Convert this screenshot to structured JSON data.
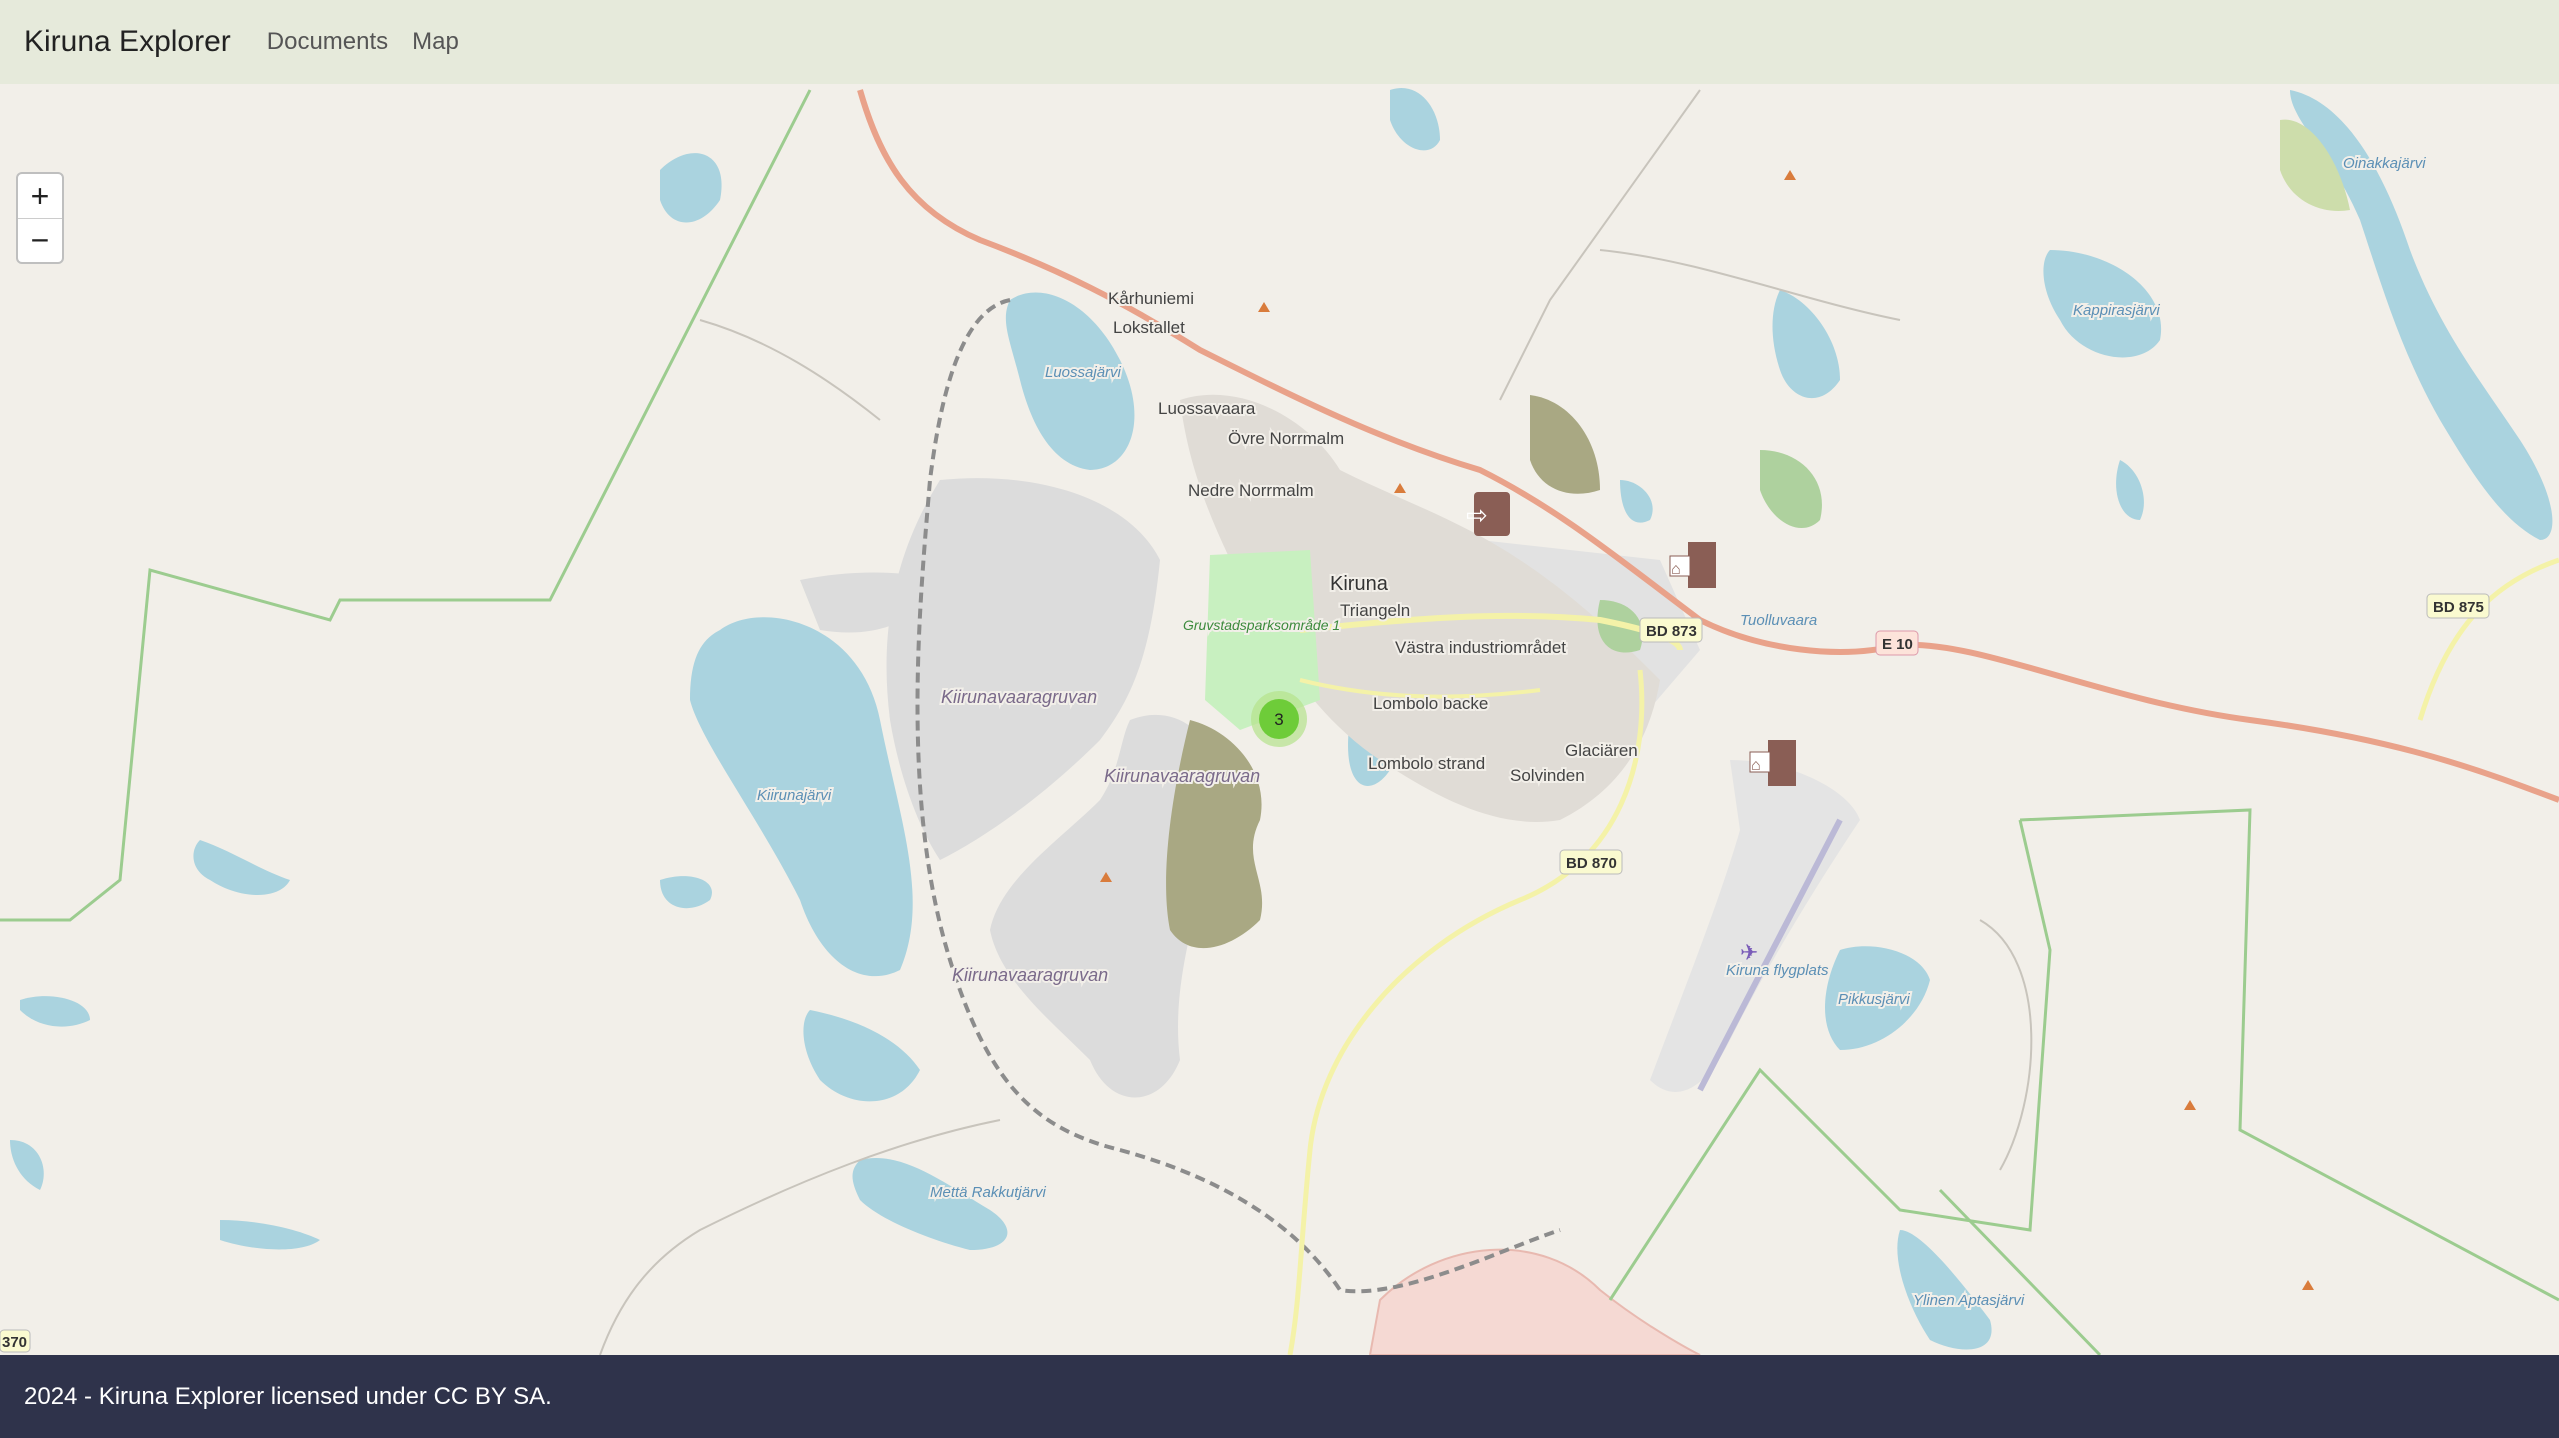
{
  "navbar": {
    "brand": "Kiruna Explorer",
    "links": [
      "Documents",
      "Map"
    ]
  },
  "map": {
    "zoom_in": "+",
    "zoom_out": "−",
    "cluster_count": "3",
    "places": [
      "Kårhuniemi",
      "Lokstallet",
      "Luossavaara",
      "Övre Norrmalm",
      "Nedre Norrmalm",
      "Kiruna",
      "Triangeln",
      "Västra industriområdet",
      "Lombolo backe",
      "Lombolo strand",
      "Solvinden",
      "Glaciären",
      "Tuolluvaara"
    ],
    "water": [
      "Luossajärvi",
      "Kiirunajärvi",
      "Oinakkajärvi",
      "Kappirasjärvi",
      "Pikkusjärvi",
      "Mettä Rakkutjärvi",
      "Ylinen Aptasjärvi"
    ],
    "mines": [
      "Kiirunavaaragruvan",
      "Kiirunavaaragruvan",
      "Kiirunavaaragruvan"
    ],
    "park": "Gruvstadsparksområde 1",
    "airport": "Kiruna flygplats",
    "roads": [
      "BD 873",
      "E 10",
      "BD 875",
      "BD 870",
      "370"
    ]
  },
  "footer": {
    "text": "2024 - Kiruna Explorer licensed under CC BY SA."
  }
}
